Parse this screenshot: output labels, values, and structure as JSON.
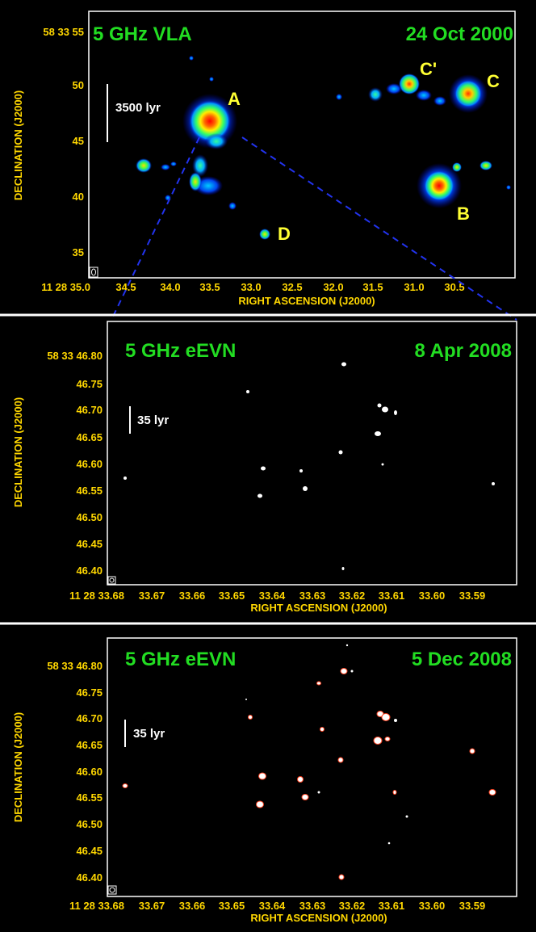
{
  "colors": {
    "axis_text": "#ffd700",
    "title_green": "#22dd22",
    "label_yellow": "#ffff33",
    "divider": "#ffffff",
    "frame": "#ffffff",
    "dashed_line": "#2233ee"
  },
  "panels": [
    {
      "id": "vla",
      "title_left": "5 GHz VLA",
      "title_right": "24 Oct 2000",
      "scale_label": "3500 lyr",
      "xlabel": "RIGHT ASCENSION (J2000)",
      "ylabel": "DECLINATION (J2000)",
      "x_ticks": [
        "11 28 35.0",
        "34.5",
        "34.0",
        "33.5",
        "33.0",
        "32.5",
        "32.0",
        "31.5",
        "31.0",
        "30.5"
      ],
      "y_ticks": [
        "58 33 55",
        "50",
        "45",
        "40",
        "35"
      ],
      "source_labels": [
        "A",
        "B",
        "C",
        "C'",
        "D"
      ],
      "beam_icon": "beam-ellipse"
    },
    {
      "id": "evn1",
      "title_left": "5 GHz eEVN",
      "title_right": "8 Apr 2008",
      "scale_label": "35 lyr",
      "xlabel": "RIGHT ASCENSION (J2000)",
      "ylabel": "DECLINATION (J2000)",
      "x_ticks": [
        "11 28 33.68",
        "33.67",
        "33.66",
        "33.65",
        "33.64",
        "33.63",
        "33.62",
        "33.61",
        "33.60",
        "33.59"
      ],
      "y_ticks": [
        "58 33 46.80",
        "46.75",
        "46.70",
        "46.65",
        "46.60",
        "46.55",
        "46.50",
        "46.45",
        "46.40"
      ],
      "beam_icon": "beam-ellipse"
    },
    {
      "id": "evn2",
      "title_left": "5 GHz eEVN",
      "title_right": "5 Dec 2008",
      "scale_label": "35 lyr",
      "xlabel": "RIGHT ASCENSION (J2000)",
      "ylabel": "DECLINATION (J2000)",
      "x_ticks": [
        "11 28 33.68",
        "33.67",
        "33.66",
        "33.65",
        "33.64",
        "33.63",
        "33.62",
        "33.61",
        "33.60",
        "33.59"
      ],
      "y_ticks": [
        "58 33 46.80",
        "46.75",
        "46.70",
        "46.65",
        "46.60",
        "46.55",
        "46.50",
        "46.45",
        "46.40"
      ],
      "beam_icon": "beam-ellipse"
    }
  ]
}
